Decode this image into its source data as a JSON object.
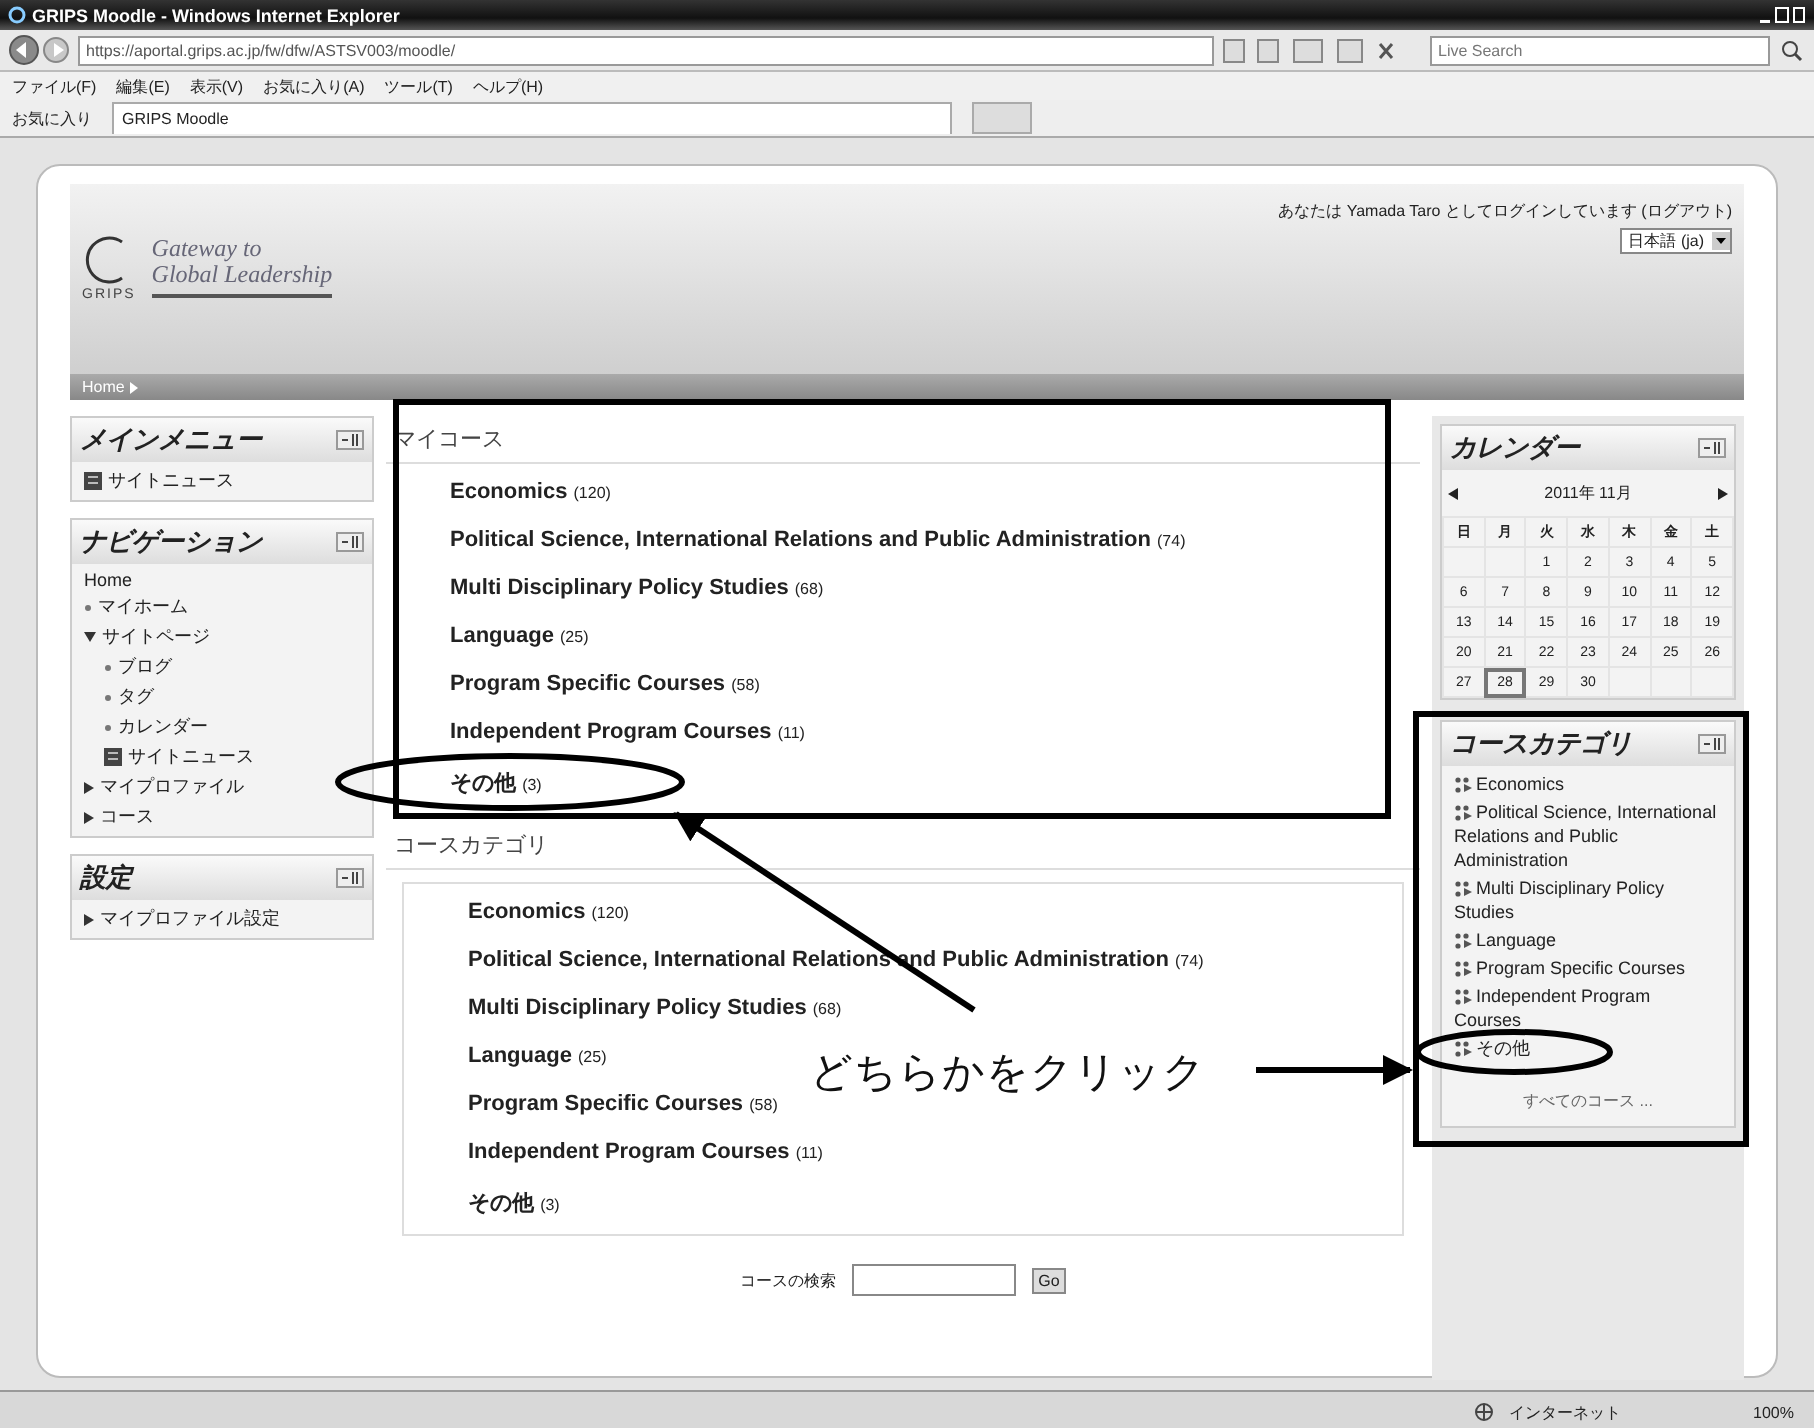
{
  "window": {
    "title": "GRIPS Moodle - Windows Internet Explorer"
  },
  "address_bar": {
    "url": "https://aportal.grips.ac.jp/fw/dfw/ASTSV003/moodle/",
    "search_placeholder": "Live Search"
  },
  "menu_bar": [
    "ファイル(F)",
    "編集(E)",
    "表示(V)",
    "お気に入り(A)",
    "ツール(T)",
    "ヘルプ(H)"
  ],
  "favorites_bar": {
    "favorites": "お気に入り",
    "tabs": [
      {
        "label": "GRIPS Moodle",
        "selected": true
      }
    ]
  },
  "header": {
    "logo_tagline": [
      "Gateway to",
      "Global Leadership"
    ],
    "logo_name": "GRIPS",
    "login_text": "あなたは Yamada Taro としてログインしています",
    "logout_link": "(ログアウト)",
    "language": "日本語 (ja)"
  },
  "breadcrumb": [
    "Home"
  ],
  "left_blocks": [
    {
      "title": "メインメニュー",
      "items": [
        {
          "kind": "news",
          "label": "サイトニュース"
        }
      ]
    },
    {
      "title": "ナビゲーション",
      "items": [
        {
          "kind": "plain",
          "label": "Home"
        },
        {
          "kind": "leaf",
          "label": "マイホーム"
        },
        {
          "kind": "branch",
          "label": "サイトページ",
          "expanded": true,
          "children": [
            {
              "kind": "leaf",
              "label": "ブログ"
            },
            {
              "kind": "leaf",
              "label": "タグ"
            },
            {
              "kind": "leaf",
              "label": "カレンダー"
            },
            {
              "kind": "news",
              "label": "サイトニュース"
            }
          ]
        },
        {
          "kind": "branch",
          "label": "マイプロファイル",
          "expanded": false
        },
        {
          "kind": "branch",
          "label": "コース",
          "expanded": false
        }
      ]
    },
    {
      "title": "設定",
      "items": [
        {
          "kind": "branch",
          "label": "マイプロファイル設定",
          "expanded": false
        }
      ]
    }
  ],
  "my_courses": {
    "title": "マイコース",
    "courses": [
      {
        "name": "Economics",
        "count": "(120)"
      },
      {
        "name": "Political Science, International Relations and Public Administration",
        "count": "(74)"
      },
      {
        "name": "Multi Disciplinary Policy Studies",
        "count": "(68)"
      },
      {
        "name": "Language",
        "count": "(25)"
      },
      {
        "name": "Program Specific Courses",
        "count": "(58)"
      },
      {
        "name": "Independent Program Courses",
        "count": "(11)"
      },
      {
        "name": "その他",
        "count": "(3)"
      }
    ]
  },
  "course_categories": {
    "title": "コースカテゴリ",
    "courses": [
      {
        "name": "Economics",
        "count": "(120)"
      },
      {
        "name": "Political Science, International Relations and Public Administration",
        "count": "(74)"
      },
      {
        "name": "Multi Disciplinary Policy Studies",
        "count": "(68)"
      },
      {
        "name": "Language",
        "count": "(25)"
      },
      {
        "name": "Program Specific Courses",
        "count": "(58)"
      },
      {
        "name": "Independent Program Courses",
        "count": "(11)"
      },
      {
        "name": "その他",
        "count": "(3)"
      }
    ]
  },
  "course_search": {
    "label": "コースの検索",
    "button": "Go"
  },
  "calendar": {
    "title": "カレンダー",
    "month": "2011年 11月",
    "weekdays": [
      "日",
      "月",
      "火",
      "水",
      "木",
      "金",
      "土"
    ],
    "weeks": [
      [
        {
          "day": "1",
          "today": false
        },
        {
          "day": "2",
          "today": false
        },
        {
          "day": "3",
          "today": false
        },
        {
          "day": "4",
          "today": false
        },
        {
          "day": "5",
          "today": false
        }
      ],
      [
        {
          "day": "6",
          "today": false
        },
        {
          "day": "7",
          "today": false
        },
        {
          "day": "8",
          "today": false
        },
        {
          "day": "9",
          "today": false
        },
        {
          "day": "10",
          "today": false
        },
        {
          "day": "11",
          "today": false
        },
        {
          "day": "12",
          "today": false
        }
      ],
      [
        {
          "day": "13",
          "today": false
        },
        {
          "day": "14",
          "today": false
        },
        {
          "day": "15",
          "today": false
        },
        {
          "day": "16",
          "today": false
        },
        {
          "day": "17",
          "today": false
        },
        {
          "day": "18",
          "today": false
        },
        {
          "day": "19",
          "today": false
        }
      ],
      [
        {
          "day": "20",
          "today": false
        },
        {
          "day": "21",
          "today": false
        },
        {
          "day": "22",
          "today": false
        },
        {
          "day": "23",
          "today": false
        },
        {
          "day": "24",
          "today": false
        },
        {
          "day": "25",
          "today": false
        },
        {
          "day": "26",
          "today": false
        }
      ],
      [
        {
          "day": "27",
          "today": false
        },
        {
          "day": "28",
          "today": true
        },
        {
          "day": "29",
          "today": false
        },
        {
          "day": "30",
          "today": false
        }
      ]
    ]
  },
  "category_block": {
    "title": "コースカテゴリ",
    "items": [
      "Economics",
      "Political Science, International Relations and Public Administration",
      "Multi Disciplinary Policy Studies",
      "Language",
      "Program Specific Courses",
      "Independent Program Courses",
      "その他"
    ],
    "all_link": "すべてのコース ..."
  },
  "status_bar": {
    "zone": "インターネット",
    "zoom": "100%"
  },
  "annotation": {
    "text": "どちらかをクリック"
  }
}
